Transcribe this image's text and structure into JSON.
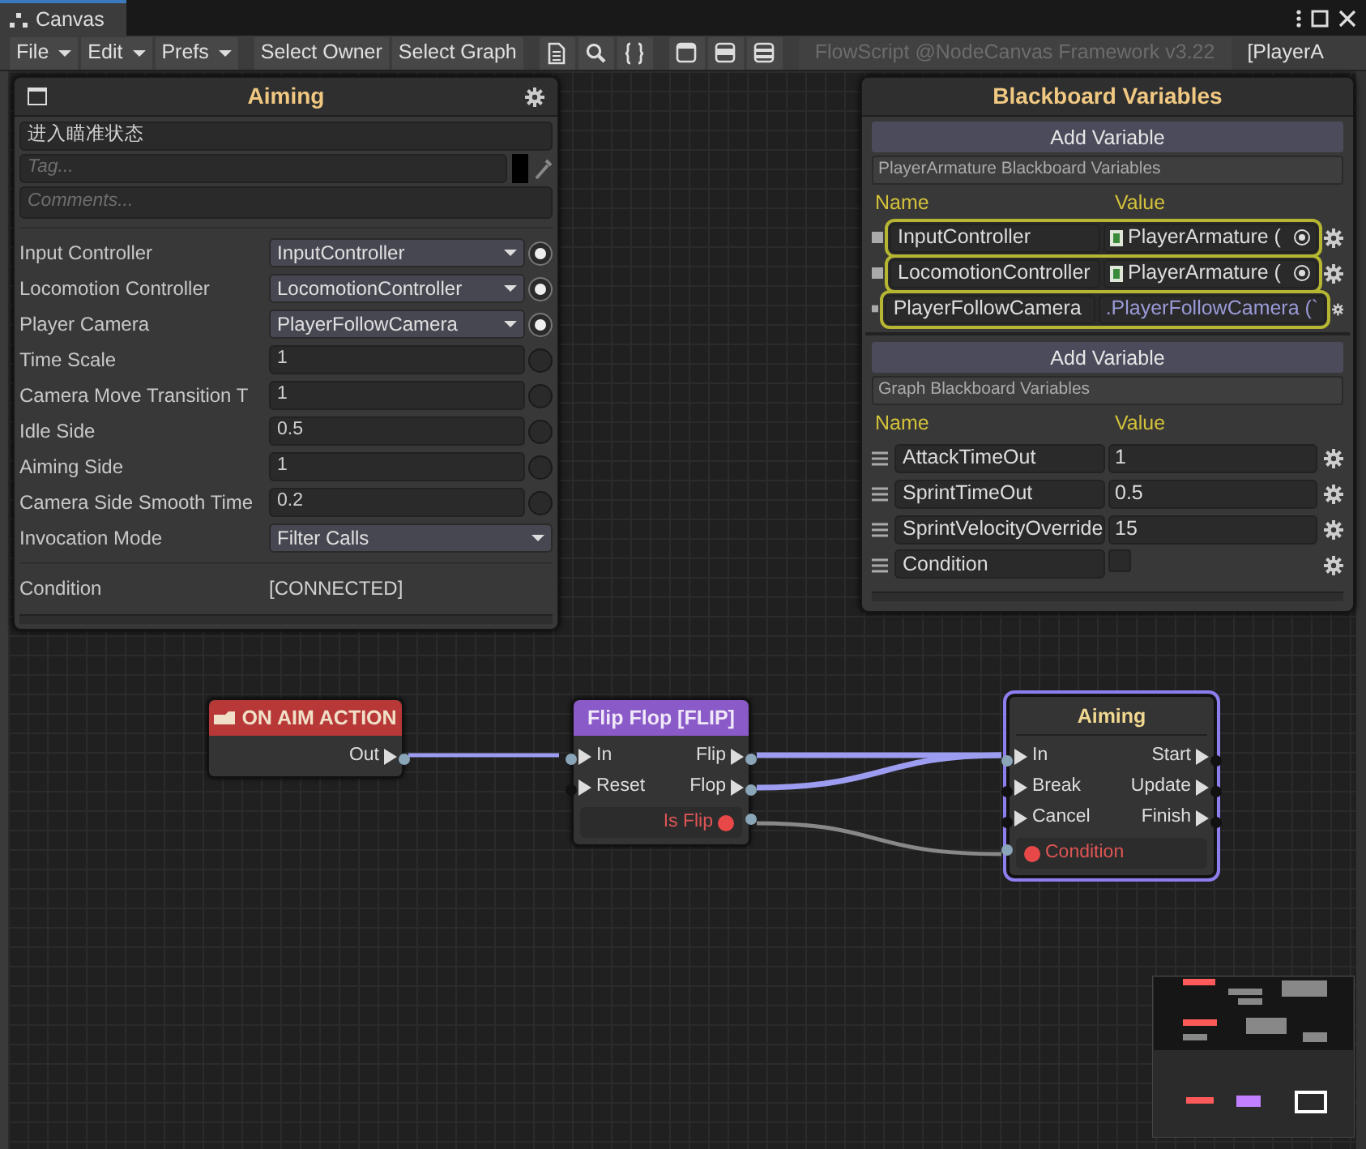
{
  "window": {
    "title": "Canvas"
  },
  "toolbar": {
    "menus": [
      "File",
      "Edit",
      "Prefs"
    ],
    "buttons": [
      "Select Owner",
      "Select Graph"
    ],
    "caption": "FlowScript @NodeCanvas Framework v3.22",
    "target": "[PlayerA"
  },
  "inspector": {
    "title": "Aiming",
    "name_value": "进入瞄准状态",
    "tag_placeholder": "Tag...",
    "comments_placeholder": "Comments...",
    "fields": [
      {
        "label": "Input Controller",
        "value": "InputController",
        "kind": "dropdown",
        "linked": true
      },
      {
        "label": "Locomotion Controller",
        "value": "LocomotionController",
        "kind": "dropdown",
        "linked": true
      },
      {
        "label": "Player Camera",
        "value": "PlayerFollowCamera",
        "kind": "dropdown",
        "linked": true
      },
      {
        "label": "Time Scale",
        "value": "1",
        "kind": "text",
        "linked": false
      },
      {
        "label": "Camera Move Transition T",
        "value": "1",
        "kind": "text",
        "linked": false
      },
      {
        "label": "Idle Side",
        "value": "0.5",
        "kind": "text",
        "linked": false
      },
      {
        "label": "Aiming Side",
        "value": "1",
        "kind": "text",
        "linked": false
      },
      {
        "label": "Camera Side Smooth Time",
        "value": "0.2",
        "kind": "text",
        "linked": false
      },
      {
        "label": "Invocation Mode",
        "value": "Filter Calls",
        "kind": "select"
      }
    ],
    "condition": {
      "label": "Condition",
      "value": "[CONNECTED]"
    }
  },
  "blackboard": {
    "title": "Blackboard Variables",
    "sections": [
      {
        "add_button": "Add Variable",
        "header": "PlayerArmature Blackboard Variables",
        "columns": [
          "Name",
          "Value"
        ],
        "variables": [
          {
            "name": "InputController",
            "value": "PlayerArmature (",
            "kind": "object",
            "highlighted": true
          },
          {
            "name": "LocomotionController",
            "value": "PlayerArmature (",
            "kind": "object",
            "highlighted": true
          },
          {
            "name": "PlayerFollowCamera",
            "value": ".PlayerFollowCamera (`",
            "kind": "bound",
            "highlighted": true
          }
        ]
      },
      {
        "add_button": "Add Variable",
        "header": "Graph Blackboard Variables",
        "columns": [
          "Name",
          "Value"
        ],
        "variables": [
          {
            "name": "AttackTimeOut",
            "value": "1",
            "kind": "text",
            "highlighted": false
          },
          {
            "name": "SprintTimeOut",
            "value": "0.5",
            "kind": "text",
            "highlighted": false
          },
          {
            "name": "SprintVelocityOverride",
            "value": "15",
            "kind": "text",
            "highlighted": false
          },
          {
            "name": "Condition",
            "kind": "checkbox",
            "checked": false,
            "highlighted": false
          }
        ]
      }
    ]
  },
  "nodes": [
    {
      "title": "ON AIM ACTION",
      "kind": "event",
      "outputs": [
        "Out"
      ]
    },
    {
      "title": "Flip Flop [FLIP]",
      "kind": "flipflop",
      "inputs": [
        "In",
        "Reset"
      ],
      "outputs": [
        "Flip",
        "Flop"
      ],
      "condition_port": "Is Flip"
    },
    {
      "title": "Aiming",
      "kind": "state",
      "selected": true,
      "inputs": [
        "In",
        "Break",
        "Cancel"
      ],
      "outputs": [
        "Start",
        "Update",
        "Finish"
      ],
      "condition_port": "Condition"
    }
  ]
}
